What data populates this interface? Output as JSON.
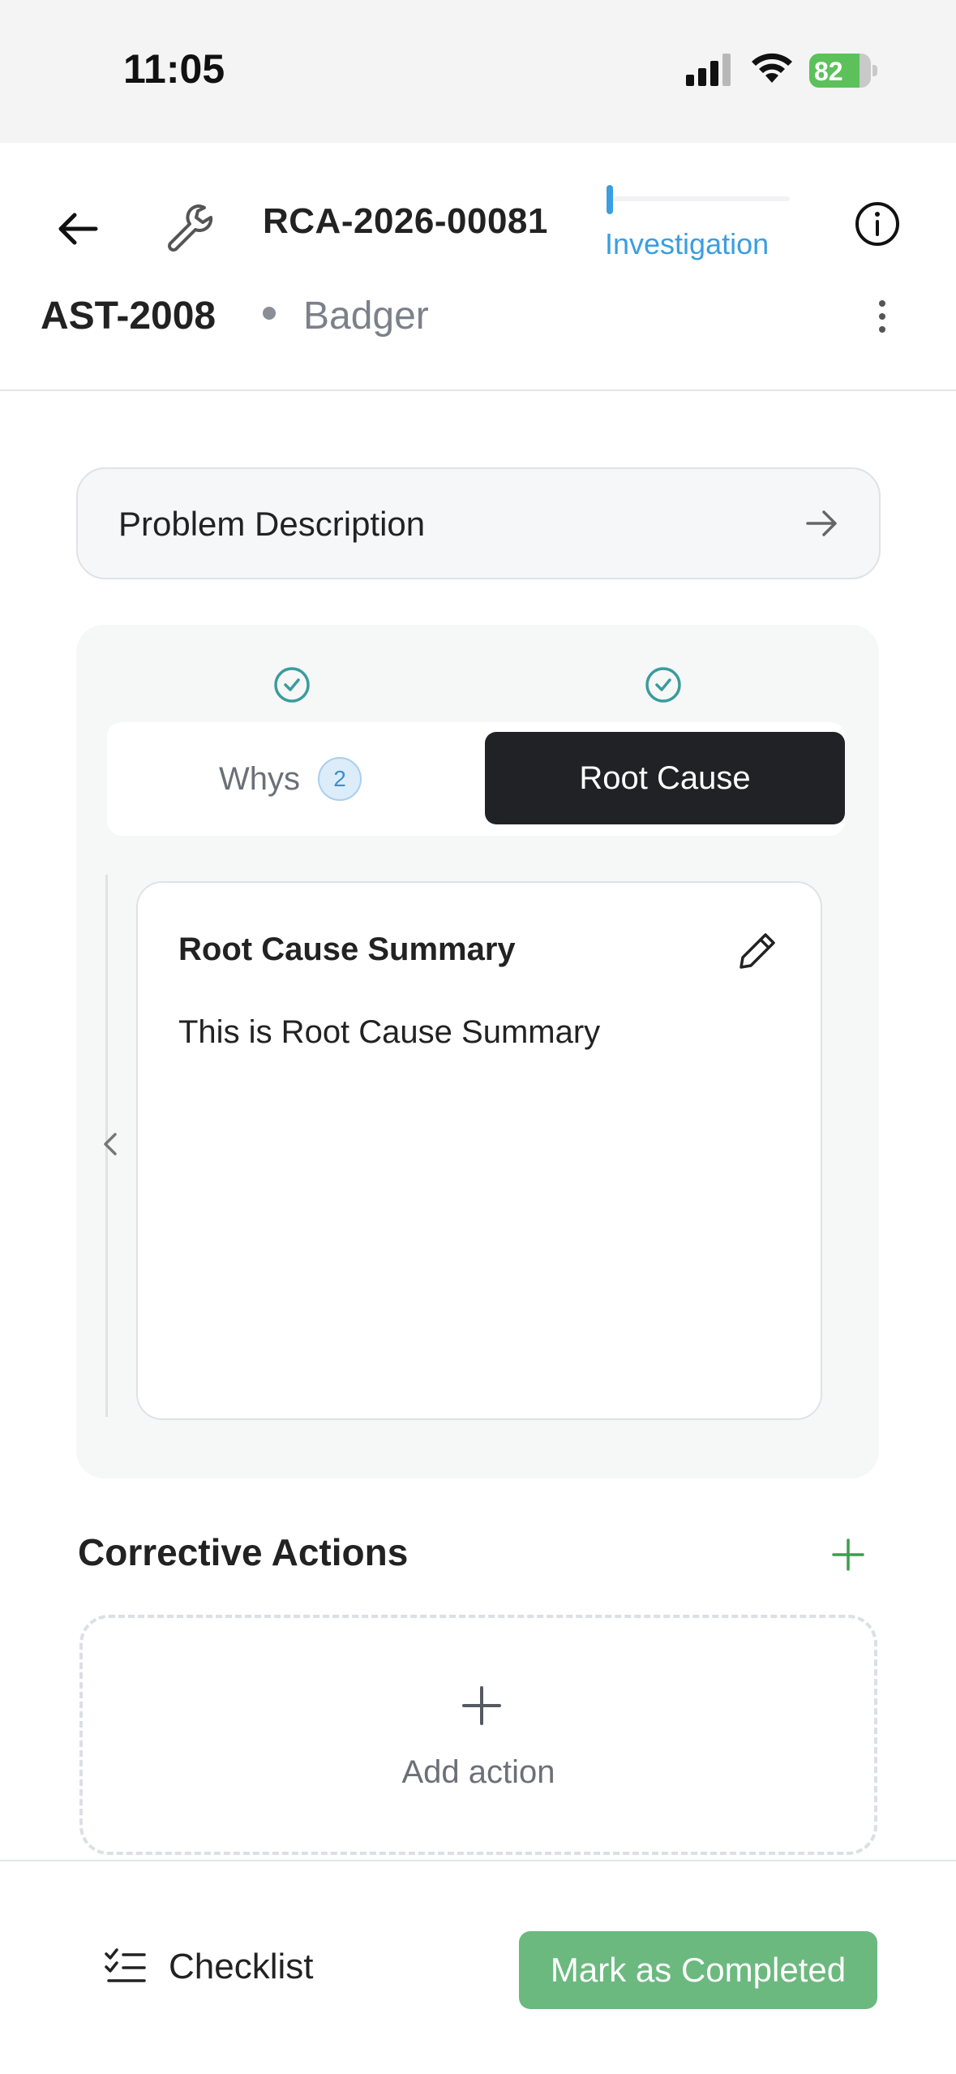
{
  "status_bar": {
    "time": "11:05",
    "battery_text": "82",
    "battery_level": 0.82,
    "battery_color": "#5cc15a"
  },
  "header": {
    "back_icon": "arrow-left-icon",
    "type_icon": "wrench-icon",
    "rca_id": "RCA-2026-00081",
    "stage": "Investigation",
    "stage_color": "#3b9ee0",
    "info_icon": "info-circle-icon",
    "asset_code": "AST-2008",
    "asset_name": "Badger",
    "more_icon": "more-vertical-icon"
  },
  "problem": {
    "label": "Problem Description",
    "icon": "arrow-right-icon"
  },
  "rca_panel": {
    "tabs": [
      {
        "label": "Whys",
        "count": "2",
        "completed": true,
        "active": false
      },
      {
        "label": "Root Cause",
        "completed": true,
        "active": true
      }
    ],
    "summary": {
      "title": "Root Cause Summary",
      "text": "This is Root Cause Summary",
      "edit_icon": "pencil-icon"
    }
  },
  "corrective_actions": {
    "title": "Corrective Actions",
    "add_icon": "plus-icon",
    "empty_label": "Add action"
  },
  "bottom_bar": {
    "checklist_label": "Checklist",
    "checklist_icon": "checklist-icon",
    "complete_label": "Mark as Completed",
    "complete_color": "#6bb97e"
  }
}
